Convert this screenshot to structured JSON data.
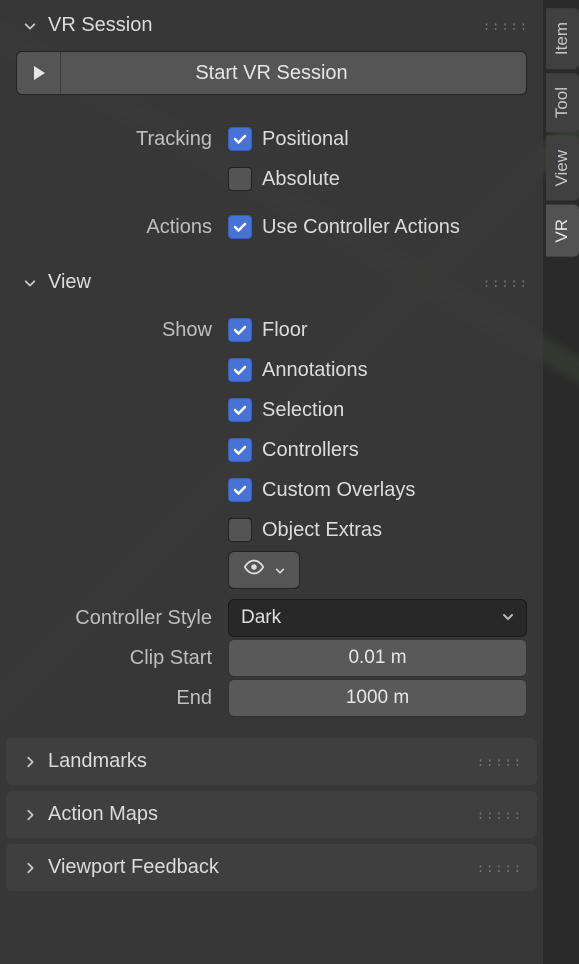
{
  "side_tabs": {
    "item": "Item",
    "tool": "Tool",
    "view": "View",
    "vr": "VR"
  },
  "vr_session": {
    "title": "VR Session",
    "start_button": "Start VR Session",
    "tracking_label": "Tracking",
    "tracking_positional": {
      "label": "Positional",
      "checked": true
    },
    "tracking_absolute": {
      "label": "Absolute",
      "checked": false
    },
    "actions_label": "Actions",
    "actions_use_controller": {
      "label": "Use Controller Actions",
      "checked": true
    }
  },
  "view": {
    "title": "View",
    "show_label": "Show",
    "show_items": [
      {
        "label": "Floor",
        "checked": true
      },
      {
        "label": "Annotations",
        "checked": true
      },
      {
        "label": "Selection",
        "checked": true
      },
      {
        "label": "Controllers",
        "checked": true
      },
      {
        "label": "Custom Overlays",
        "checked": true
      },
      {
        "label": "Object Extras",
        "checked": false
      }
    ],
    "controller_style_label": "Controller Style",
    "controller_style_value": "Dark",
    "clip_start_label": "Clip Start",
    "clip_start_value": "0.01 m",
    "clip_end_label": "End",
    "clip_end_value": "1000 m"
  },
  "collapsed": {
    "landmarks": "Landmarks",
    "action_maps": "Action Maps",
    "viewport_feedback": "Viewport Feedback"
  }
}
